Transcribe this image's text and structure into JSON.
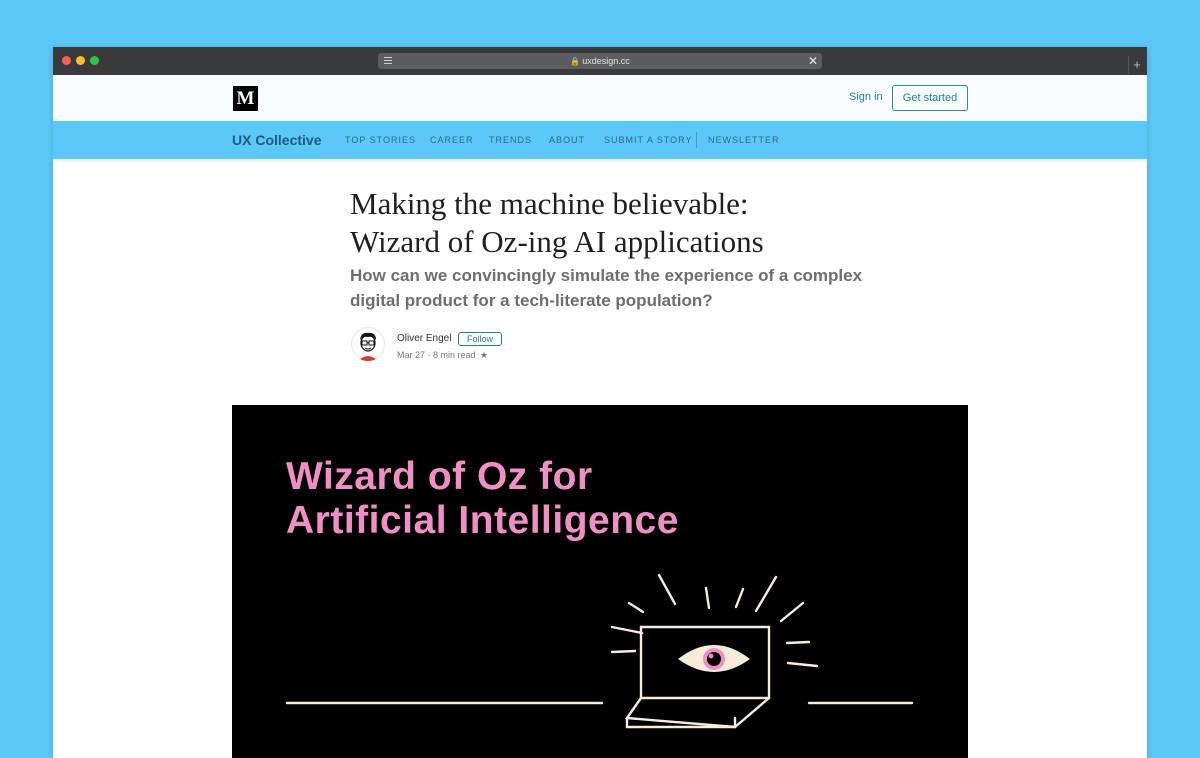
{
  "browser": {
    "url": "uxdesign.cc",
    "newtab_label": "+",
    "close_label": "✕",
    "lock_glyph": "🔒"
  },
  "header": {
    "logo": "M",
    "signin_label": "Sign in",
    "get_started_label": "Get started"
  },
  "publication": {
    "name": "UX Collective",
    "nav": [
      "TOP STORIES",
      "CAREER",
      "TRENDS",
      "ABOUT",
      "SUBMIT A STORY",
      "NEWSLETTER"
    ]
  },
  "article": {
    "title_line1": "Making the machine believable:",
    "title_line2": "Wizard of Oz-ing AI applications",
    "subtitle_line1": "How can we convincingly simulate the experience of a complex",
    "subtitle_line2": "digital product for a tech-literate population?",
    "author": "Oliver Engel",
    "follow_label": "Follow",
    "meta": "Mar 27 · 8 min read",
    "star_glyph": "★"
  },
  "hero": {
    "title_line1": "Wizard of Oz for",
    "title_line2": "Artificial Intelligence",
    "accent_color": "#f08fc6",
    "background_color": "#000000"
  }
}
